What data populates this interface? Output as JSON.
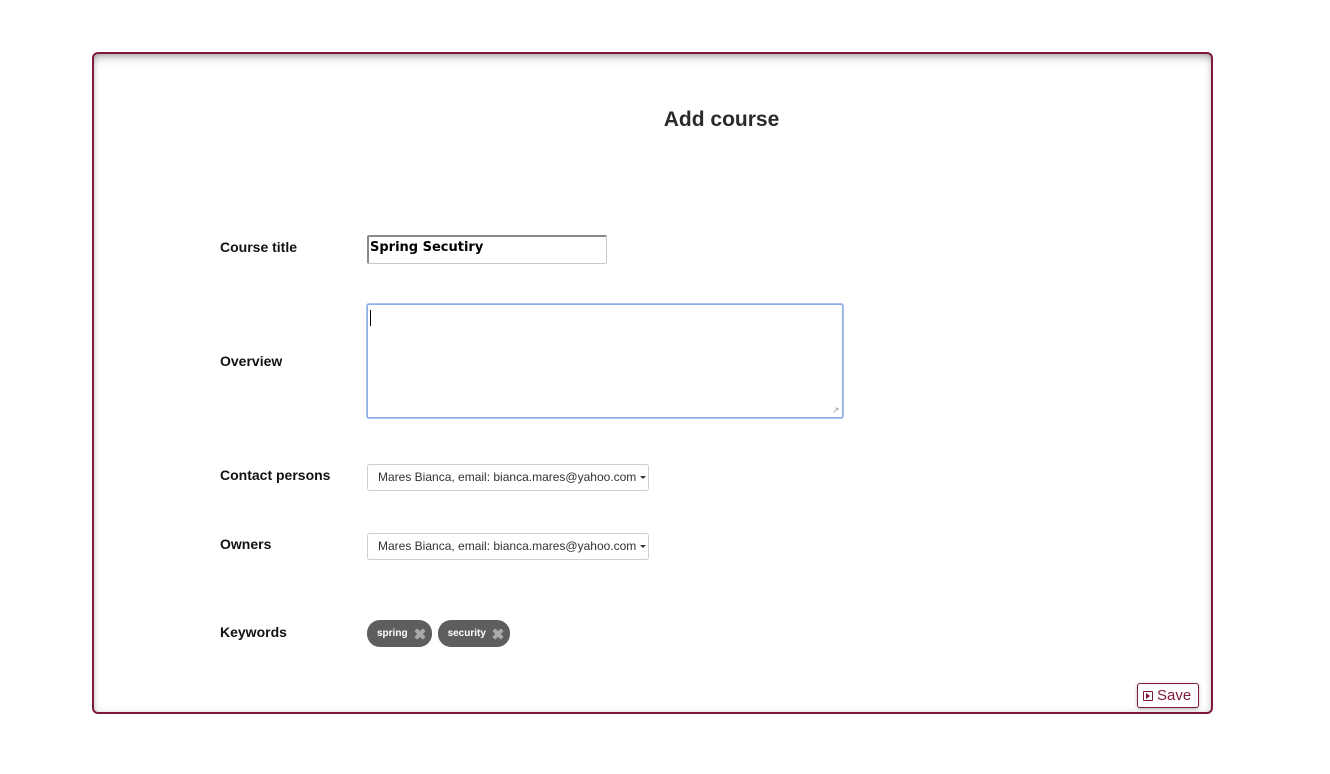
{
  "page": {
    "title": "Add course",
    "accent_color": "#7d1a3d"
  },
  "form": {
    "course_title": {
      "label": "Course title",
      "value": "Spring Secutiry"
    },
    "overview": {
      "label": "Overview",
      "value": ""
    },
    "contact_persons": {
      "label": "Contact persons",
      "selected": "Mares Bianca, email: bianca.mares@yahoo.com"
    },
    "owners": {
      "label": "Owners",
      "selected": "Mares Bianca, email: bianca.mares@yahoo.com"
    },
    "keywords": {
      "label": "Keywords",
      "tags": [
        "spring",
        "security"
      ]
    }
  },
  "actions": {
    "save_label": "Save",
    "save_icon": "play-square-icon"
  }
}
